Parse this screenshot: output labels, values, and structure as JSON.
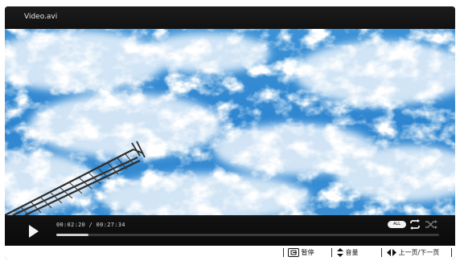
{
  "window": {
    "title": "Video.avi"
  },
  "player": {
    "current_time": "00:02:20",
    "total_time": "00:27:34",
    "time_separator": "/",
    "progress": 0.085,
    "mode_pill": "ALL"
  },
  "hints": {
    "pause_label": "暂停",
    "volume_label": "音量",
    "page_label": "上一页/下一页"
  },
  "icons": {
    "play": "play-icon",
    "repeat": "repeat-icon",
    "shuffle": "shuffle-icon",
    "pause_key": "pause-key-icon",
    "volume_key": "up-down-arrows-icon",
    "page_key": "left-right-arrows-icon"
  },
  "colors": {
    "frame": "#141414",
    "sky": "#2f86d0",
    "cloud": "#eef5fc",
    "tower": "#2c2c2c"
  }
}
